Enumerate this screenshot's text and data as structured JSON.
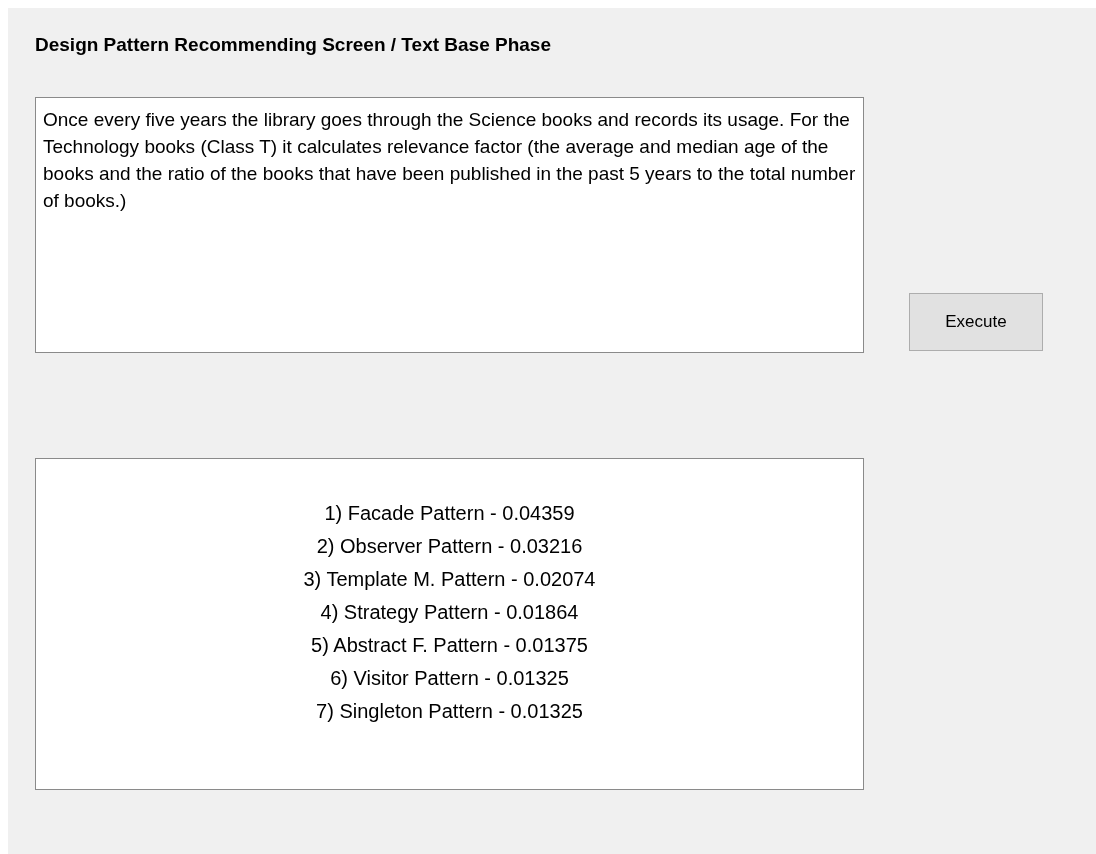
{
  "window": {
    "title": "Design Pattern Recommending Screen / Text Base Phase"
  },
  "input": {
    "value": "Once every five years the library goes through the Science books and records its usage. For the Technology books (Class T) it calculates relevance factor (the average and median age of the books and the ratio of the books that have been published in the past 5 years to the total number of books.)"
  },
  "execute_button": {
    "label": "Execute"
  },
  "results": [
    "1) Facade Pattern - 0.04359",
    "2) Observer Pattern - 0.03216",
    "3) Template M. Pattern - 0.02074",
    "4) Strategy Pattern - 0.01864",
    "5) Abstract F. Pattern - 0.01375",
    "6) Visitor Pattern - 0.01325",
    "7) Singleton Pattern - 0.01325"
  ]
}
